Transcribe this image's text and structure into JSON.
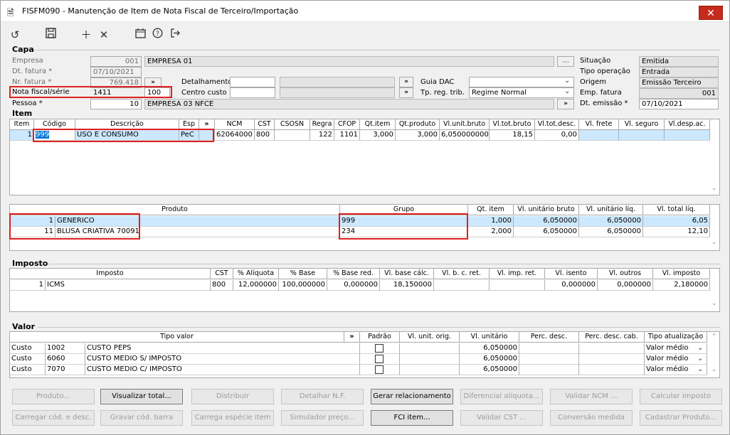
{
  "window": {
    "title": "FISFM090 - Manutenção de Item de Nota Fiscal de Terceiro/Importação",
    "close": "✕"
  },
  "toolbar": {
    "icons": [
      "undo-icon",
      "save-icon",
      "add-icon",
      "delete-icon",
      "calendar-icon",
      "help-icon",
      "exit-icon"
    ]
  },
  "capa": {
    "section_label": "Capa",
    "empresa_label": "Empresa",
    "empresa_code": "001",
    "empresa_name": "EMPRESA 01",
    "dt_fatura_label": "Dt. fatura *",
    "dt_fatura": "07/10/2021",
    "nr_fatura_label": "Nr. fatura *",
    "nr_fatura": "769.418",
    "nota_label": "Nota fiscal/série",
    "nota": "1411",
    "serie": "100",
    "pessoa_label": "Pessoa *",
    "pessoa_code": "10",
    "pessoa_name": "EMPRESA 03 NFCE",
    "detalhamento_label": "Detalhamento",
    "centro_custo_label": "Centro custo",
    "guia_dac_label": "Guia DAC",
    "tp_reg_label": "Tp. reg. trib.",
    "tp_reg_value": "Regime Normal",
    "situacao_label": "Situação",
    "situacao": "Emitida",
    "tipo_operacao_label": "Tipo operação",
    "tipo_operacao": "Entrada",
    "origem_label": "Origem",
    "origem": "Emissão Terceiro",
    "emp_fatura_label": "Emp. fatura",
    "emp_fatura": "001",
    "dt_emissao_label": "Dt. emissão *",
    "dt_emissao": "07/10/2021",
    "expand_btn": "»",
    "lookup_btn": "..."
  },
  "item": {
    "section_label": "Item",
    "columns": [
      "Item",
      "Código",
      "Descrição",
      "Esp",
      "»",
      "NCM",
      "CST",
      "CSOSN",
      "Regra",
      "CFOP",
      "Qt.item",
      "Qt.produto",
      "Vl.unit.bruto",
      "Vl.tot.bruto",
      "Vl.tot.desc.",
      "Vl. frete",
      "Vl. seguro",
      "Vl.desp.ac."
    ],
    "rows": [
      [
        "1",
        "999",
        "USO E CONSUMO",
        "PeC",
        "",
        "62064000",
        "800",
        "",
        "122",
        "1101",
        "3,000",
        "3,000",
        "6,0500000000",
        "18,15",
        "0,00",
        "",
        "",
        ""
      ]
    ]
  },
  "produtos": {
    "columns": [
      "Produto",
      "Grupo",
      "Qt. item",
      "Vl. unitário bruto",
      "Vl. unitário líq.",
      "Vl. total líq."
    ],
    "rows": [
      [
        "1",
        "GENERICO",
        "999",
        "1,000",
        "6,050000",
        "6,050000",
        "6,05"
      ],
      [
        "11",
        "BLUSA CRIATIVA 70091",
        "234",
        "2,000",
        "6,050000",
        "6,050000",
        "12,10"
      ]
    ]
  },
  "imposto": {
    "section_label": "Imposto",
    "columns": [
      "Imposto",
      "CST",
      "% Alíquota",
      "% Base",
      "% Base red.",
      "Vl. base cálc.",
      "Vl. b. c. ret.",
      "Vl. imp. ret.",
      "Vl. isento",
      "Vl. outros",
      "Vl. imposto"
    ],
    "rows": [
      [
        "1",
        "ICMS",
        "800",
        "12,000000",
        "100,000000",
        "0,000000",
        "18,150000",
        "",
        "",
        "0,000000",
        "0,000000",
        "2,180000"
      ]
    ]
  },
  "valor": {
    "section_label": "Valor",
    "columns": [
      "Tipo valor",
      "»",
      "Padrão",
      "Vl. unit. orig.",
      "Vl. unitário",
      "Perc. desc.",
      "Perc. desc. cab.",
      "Tipo atualização"
    ],
    "rows": [
      [
        "Custo",
        "1002",
        "CUSTO PEPS",
        "6,050000",
        "Valor médio"
      ],
      [
        "Custo",
        "6060",
        "CUSTO MEDIO S/ IMPOSTO",
        "6,050000",
        "Valor médio"
      ],
      [
        "Custo",
        "7070",
        "CUSTO MEDIO C/ IMPOSTO",
        "6,050000",
        "Valor médio"
      ]
    ]
  },
  "buttons_row1": [
    "Produto...",
    "Visualizar total...",
    "Distribuir",
    "Detalhar N.F.",
    "Gerar relacionamento",
    "Diferencial alíquota...",
    "Validar NCM ...",
    "Calcular imposto"
  ],
  "buttons_row2": [
    "Carregar cód. e desc.",
    "Gravar cód. barra",
    "Carrega espécie item",
    "Simulador preço...",
    "FCI item...",
    "Validar CST ...",
    "Conversão medida",
    "Cadastrar Produto..."
  ],
  "buttons_enabled": [
    "Visualizar total...",
    "Gerar relacionamento",
    "FCI item..."
  ]
}
